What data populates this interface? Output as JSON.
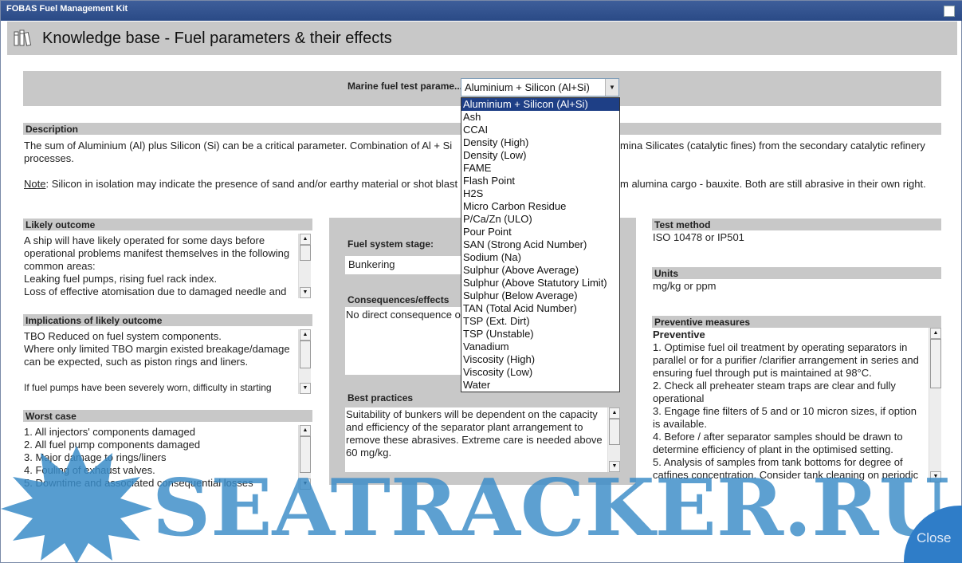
{
  "window": {
    "title": "FOBAS Fuel Management Kit"
  },
  "header": {
    "title": "Knowledge base - Fuel parameters & their effects",
    "icon": "books-icon"
  },
  "selector": {
    "label": "Marine fuel test parame...",
    "value": "Aluminium + Silicon (Al+Si)",
    "options": [
      "Aluminium + Silicon (Al+Si)",
      "Ash",
      "CCAI",
      "Density (High)",
      "Density (Low)",
      "FAME",
      "Flash Point",
      "H2S",
      "Micro Carbon Residue",
      "P/Ca/Zn (ULO)",
      "Pour Point",
      "SAN (Strong Acid Number)",
      "Sodium (Na)",
      "Sulphur (Above Average)",
      "Sulphur (Above Statutory Limit)",
      "Sulphur (Below Average)",
      "TAN (Total Acid Number)",
      "TSP (Ext. Dirt)",
      "TSP (Unstable)",
      "Vanadium",
      "Viscosity (High)",
      "Viscosity (Low)",
      "Water"
    ]
  },
  "description": {
    "heading": "Description",
    "line1_a": "The sum of Aluminium (Al) plus Silicon (Si) can be a critical parameter. Combination of Al + Si",
    "line1_b": "mina Silicates (catalytic fines) from the secondary catalytic refinery",
    "line2": "processes.",
    "note_label": "Note",
    "note_a": ": Silicon in isolation may indicate the presence of sand and/or earthy material or shot blast",
    "note_b": "m alumina cargo - bauxite. Both are still abrasive in their own right."
  },
  "likely_outcome": {
    "heading": "Likely outcome",
    "lines": [
      "A ship will have likely operated for some days before",
      "operational problems manifest themselves in the following",
      "common areas:",
      "Leaking fuel pumps, rising fuel rack index.",
      "Loss of effective atomisation due to damaged needle and"
    ]
  },
  "implications": {
    "heading": "Implications of likely outcome",
    "lines": [
      "TBO Reduced on fuel system components.",
      "Where only limited TBO margin existed breakage/damage",
      "can be expected, such as piston rings and liners.",
      "",
      "If fuel pumps have been severely worn, difficulty in starting"
    ]
  },
  "worst_case": {
    "heading": "Worst case",
    "lines": [
      "1. All injectors' components damaged",
      "2. All fuel pump components damaged",
      "3. Major damage to rings/liners",
      "4. Fouling of exhaust valves.",
      "5. Downtime and associated consequential losses"
    ]
  },
  "middle": {
    "stage_label": "Fuel system stage:",
    "stage_value": "Bunkering",
    "consequences_label": "Consequences/effects",
    "consequences_value": "No direct consequence o",
    "best_label": "Best practices",
    "best_lines": [
      "Suitability of bunkers will be dependent on the capacity",
      "and efficiency of the separator plant arrangement to",
      "remove these abrasives. Extreme care is needed above",
      "60 mg/kg."
    ]
  },
  "test_method": {
    "heading": "Test method",
    "value": "ISO 10478 or IP501"
  },
  "units": {
    "heading": "Units",
    "value": "mg/kg or ppm"
  },
  "preventive": {
    "heading": "Preventive measures",
    "subheading": "Preventive",
    "lines": [
      "1. Optimise fuel oil treatment by operating separators in",
      "parallel or for a purifier /clarifier arrangement in series and",
      "ensuring fuel through put is maintained at 98°C.",
      "2. Check all preheater steam traps are clear and fully",
      "operational",
      "3. Engage fine filters of 5 and or 10 micron sizes, if option",
      "is available.",
      "4. Before / after separator samples should be drawn to",
      "determine efficiency of plant in the optimised setting.",
      "5. Analysis of samples from tank bottoms for degree of",
      "catfines concentration. Consider tank cleaning on periodic"
    ]
  },
  "watermark": {
    "text": "SEATRACKER.RU",
    "color": "#3a8cc8"
  },
  "close_label": "Close"
}
